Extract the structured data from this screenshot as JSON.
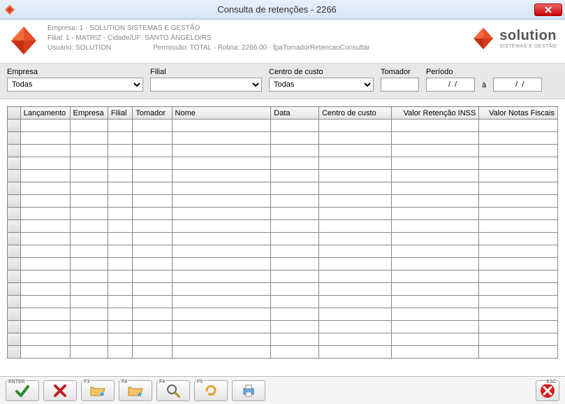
{
  "window": {
    "title": "Consulta de retenções - 2266"
  },
  "header": {
    "line1": "Empresa: 1 - SOLUTION SISTEMAS E GESTÃO",
    "line2": "Filial: 1 - MATRIZ - Cidade/UF: SANTO ÂNGELO/RS",
    "line3_left": "Usuário: SOLUTION",
    "line3_right": "Permissão: TOTAL - Rotina: 2266.00 - fpaTomadorRetencaoConsultar",
    "brand": "solution",
    "brand_sub": "SISTEMAS E GESTÃO"
  },
  "filters": {
    "empresa": {
      "label": "Empresa",
      "value": "Todas"
    },
    "filial": {
      "label": "Filial",
      "value": ""
    },
    "centro": {
      "label": "Centro de custo",
      "value": "Todas"
    },
    "tomador": {
      "label": "Tomador",
      "value": ""
    },
    "periodo": {
      "label": "Período",
      "from": "  /  /",
      "sep": "à",
      "to": "  /  /"
    }
  },
  "grid": {
    "columns": [
      "Lançamento",
      "Empresa",
      "Filial",
      "Tomador",
      "Nome",
      "Data",
      "Centro de custo",
      "Valor Retenção INSS",
      "Valor Notas Fiscais"
    ],
    "rows": 19
  },
  "toolbar": {
    "keys": {
      "enter": "ENTER",
      "f3": "F3",
      "f8": "F8",
      "f4": "F4",
      "f5": "F5",
      "esc": "ESC"
    }
  }
}
